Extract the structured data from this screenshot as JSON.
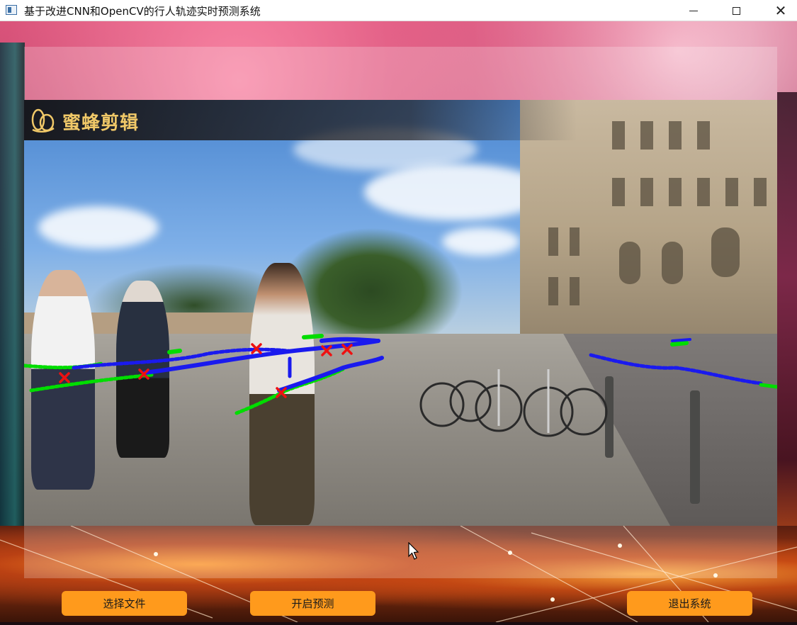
{
  "window": {
    "title": "基于改进CNN和OpenCV的行人轨迹实时预测系统",
    "controls": {
      "minimize": "minimize-icon",
      "maximize": "maximize-icon",
      "close": "close-icon"
    }
  },
  "video": {
    "watermark_text": "蜜蜂剪辑",
    "trajectory_colors": {
      "history": "#00dd00",
      "prediction": "#1a1aee",
      "marker": "#ee1111"
    }
  },
  "buttons": {
    "select_file": "选择文件",
    "start_prediction": "开启预测",
    "exit_system": "退出系统"
  },
  "colors": {
    "button_bg": "#ff9a1c",
    "title_bar": "#ffffff"
  }
}
